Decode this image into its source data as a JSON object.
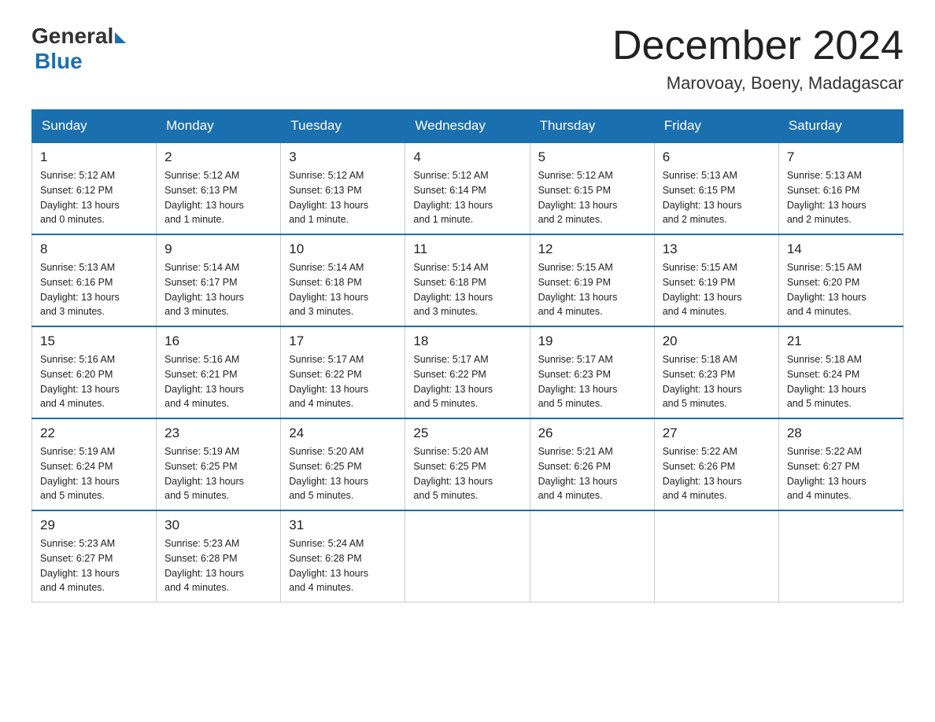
{
  "header": {
    "logo_general": "General",
    "logo_blue": "Blue",
    "month_title": "December 2024",
    "location": "Marovoay, Boeny, Madagascar"
  },
  "days_of_week": [
    "Sunday",
    "Monday",
    "Tuesday",
    "Wednesday",
    "Thursday",
    "Friday",
    "Saturday"
  ],
  "weeks": [
    [
      {
        "day": "1",
        "sunrise": "5:12 AM",
        "sunset": "6:12 PM",
        "daylight": "13 hours and 0 minutes."
      },
      {
        "day": "2",
        "sunrise": "5:12 AM",
        "sunset": "6:13 PM",
        "daylight": "13 hours and 1 minute."
      },
      {
        "day": "3",
        "sunrise": "5:12 AM",
        "sunset": "6:13 PM",
        "daylight": "13 hours and 1 minute."
      },
      {
        "day": "4",
        "sunrise": "5:12 AM",
        "sunset": "6:14 PM",
        "daylight": "13 hours and 1 minute."
      },
      {
        "day": "5",
        "sunrise": "5:12 AM",
        "sunset": "6:15 PM",
        "daylight": "13 hours and 2 minutes."
      },
      {
        "day": "6",
        "sunrise": "5:13 AM",
        "sunset": "6:15 PM",
        "daylight": "13 hours and 2 minutes."
      },
      {
        "day": "7",
        "sunrise": "5:13 AM",
        "sunset": "6:16 PM",
        "daylight": "13 hours and 2 minutes."
      }
    ],
    [
      {
        "day": "8",
        "sunrise": "5:13 AM",
        "sunset": "6:16 PM",
        "daylight": "13 hours and 3 minutes."
      },
      {
        "day": "9",
        "sunrise": "5:14 AM",
        "sunset": "6:17 PM",
        "daylight": "13 hours and 3 minutes."
      },
      {
        "day": "10",
        "sunrise": "5:14 AM",
        "sunset": "6:18 PM",
        "daylight": "13 hours and 3 minutes."
      },
      {
        "day": "11",
        "sunrise": "5:14 AM",
        "sunset": "6:18 PM",
        "daylight": "13 hours and 3 minutes."
      },
      {
        "day": "12",
        "sunrise": "5:15 AM",
        "sunset": "6:19 PM",
        "daylight": "13 hours and 4 minutes."
      },
      {
        "day": "13",
        "sunrise": "5:15 AM",
        "sunset": "6:19 PM",
        "daylight": "13 hours and 4 minutes."
      },
      {
        "day": "14",
        "sunrise": "5:15 AM",
        "sunset": "6:20 PM",
        "daylight": "13 hours and 4 minutes."
      }
    ],
    [
      {
        "day": "15",
        "sunrise": "5:16 AM",
        "sunset": "6:20 PM",
        "daylight": "13 hours and 4 minutes."
      },
      {
        "day": "16",
        "sunrise": "5:16 AM",
        "sunset": "6:21 PM",
        "daylight": "13 hours and 4 minutes."
      },
      {
        "day": "17",
        "sunrise": "5:17 AM",
        "sunset": "6:22 PM",
        "daylight": "13 hours and 4 minutes."
      },
      {
        "day": "18",
        "sunrise": "5:17 AM",
        "sunset": "6:22 PM",
        "daylight": "13 hours and 5 minutes."
      },
      {
        "day": "19",
        "sunrise": "5:17 AM",
        "sunset": "6:23 PM",
        "daylight": "13 hours and 5 minutes."
      },
      {
        "day": "20",
        "sunrise": "5:18 AM",
        "sunset": "6:23 PM",
        "daylight": "13 hours and 5 minutes."
      },
      {
        "day": "21",
        "sunrise": "5:18 AM",
        "sunset": "6:24 PM",
        "daylight": "13 hours and 5 minutes."
      }
    ],
    [
      {
        "day": "22",
        "sunrise": "5:19 AM",
        "sunset": "6:24 PM",
        "daylight": "13 hours and 5 minutes."
      },
      {
        "day": "23",
        "sunrise": "5:19 AM",
        "sunset": "6:25 PM",
        "daylight": "13 hours and 5 minutes."
      },
      {
        "day": "24",
        "sunrise": "5:20 AM",
        "sunset": "6:25 PM",
        "daylight": "13 hours and 5 minutes."
      },
      {
        "day": "25",
        "sunrise": "5:20 AM",
        "sunset": "6:25 PM",
        "daylight": "13 hours and 5 minutes."
      },
      {
        "day": "26",
        "sunrise": "5:21 AM",
        "sunset": "6:26 PM",
        "daylight": "13 hours and 4 minutes."
      },
      {
        "day": "27",
        "sunrise": "5:22 AM",
        "sunset": "6:26 PM",
        "daylight": "13 hours and 4 minutes."
      },
      {
        "day": "28",
        "sunrise": "5:22 AM",
        "sunset": "6:27 PM",
        "daylight": "13 hours and 4 minutes."
      }
    ],
    [
      {
        "day": "29",
        "sunrise": "5:23 AM",
        "sunset": "6:27 PM",
        "daylight": "13 hours and 4 minutes."
      },
      {
        "day": "30",
        "sunrise": "5:23 AM",
        "sunset": "6:28 PM",
        "daylight": "13 hours and 4 minutes."
      },
      {
        "day": "31",
        "sunrise": "5:24 AM",
        "sunset": "6:28 PM",
        "daylight": "13 hours and 4 minutes."
      },
      null,
      null,
      null,
      null
    ]
  ]
}
